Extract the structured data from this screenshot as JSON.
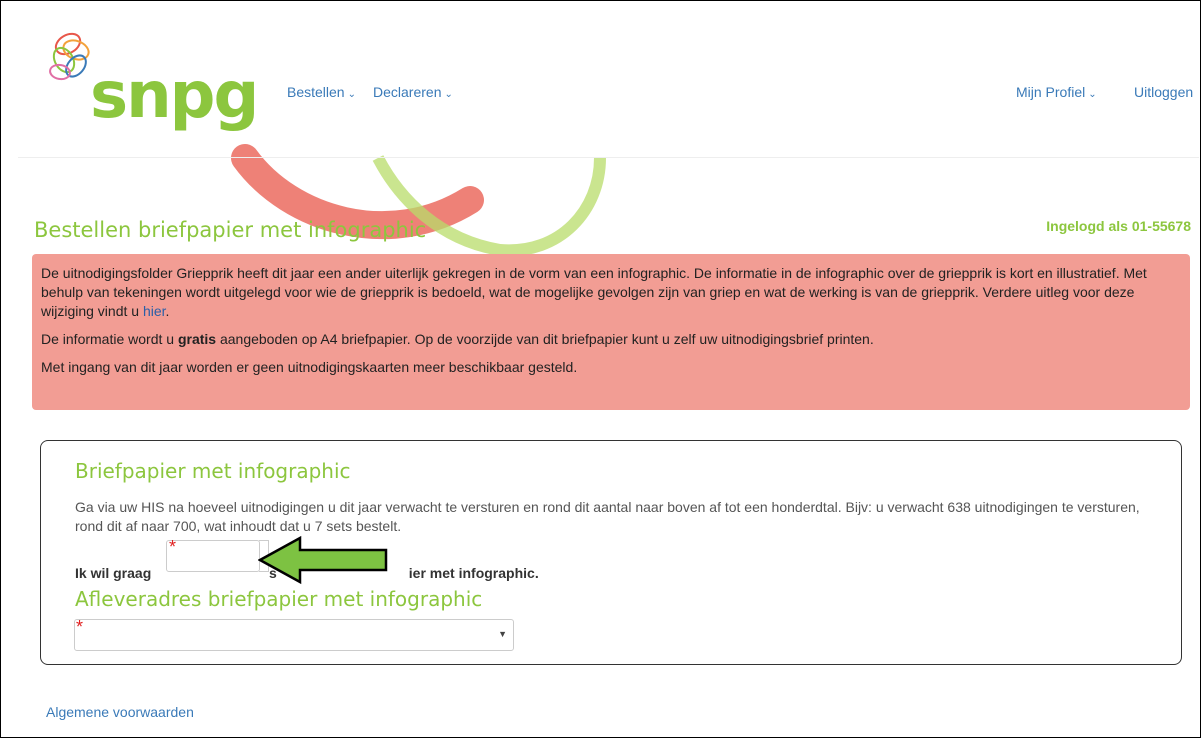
{
  "brand": {
    "logo_text": "snpg",
    "logo_color": "#8cc63e"
  },
  "nav": {
    "left": [
      {
        "label": "Bestellen",
        "icon": "chevron-down-icon"
      },
      {
        "label": "Declareren",
        "icon": "chevron-down-icon"
      }
    ],
    "right": [
      {
        "label": "Mijn Profiel",
        "icon": "chevron-down-icon"
      },
      {
        "label": "Uitloggen"
      }
    ]
  },
  "page": {
    "title": "Bestellen briefpapier met infographic",
    "logged_in": "Ingelogd als 01-55678"
  },
  "alert": {
    "p1_text": "De uitnodigingsfolder Griepprik heeft dit jaar een ander uiterlijk gekregen in de vorm van een infographic. De informatie in de infographic over de griepprik is kort en illustratief. Met behulp van tekeningen wordt uitgelegd voor wie de griepprik is bedoeld, wat de mogelijke gevolgen zijn van griep en wat de werking is van de griepprik. Verdere uitleg voor deze wijziging vindt u ",
    "p1_link": "hier",
    "p1_end": ".",
    "p2_before": "De informatie wordt u ",
    "p2_bold": "gratis",
    "p2_after": " aangeboden op A4 briefpapier. Op de voorzijde van dit briefpapier kunt u zelf uw uitnodigingsbrief printen.",
    "p3": "Met ingang van dit jaar worden er geen uitnodigingskaarten meer beschikbaar gesteld.",
    "background": "#f29d94"
  },
  "form": {
    "section1_title": "Briefpapier met infographic",
    "section1_text": "Ga via uw HIS na hoeveel uitnodigingen u dit jaar verwacht te versturen en rond dit aantal naar boven af tot een honderdtal. Bijv: u verwacht 638 uitnodigingen te versturen, rond dit af naar 700, wat inhoudt dat u 7 sets bestelt.",
    "label_before": "Ik wil graag",
    "label_after_prefix": "s",
    "label_after": "ier met infographic.",
    "quantity_value": "",
    "required_mark": "*",
    "section2_title": "Afleveradres briefpapier met infographic",
    "address_value": ""
  },
  "footer": {
    "link": "Algemene voorwaarden"
  },
  "colors": {
    "accent": "#8cc63e",
    "link": "#3a7ab8",
    "required": "#e02020",
    "arrow": "#7dc242"
  }
}
